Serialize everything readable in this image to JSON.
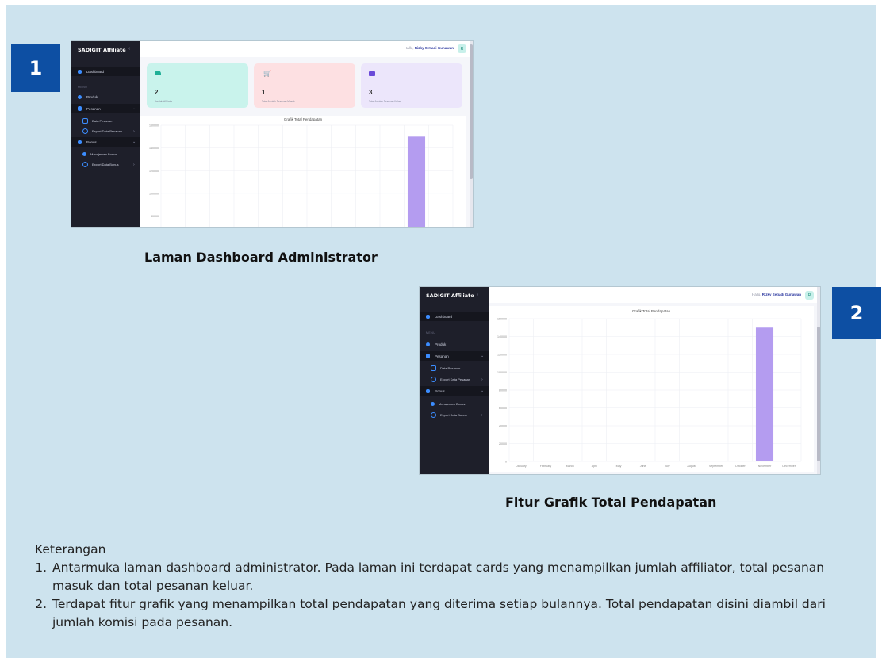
{
  "badges": {
    "first": "1",
    "second": "2"
  },
  "captions": {
    "first": "Laman Dashboard Administrator",
    "second": "Fitur Grafik Total Pendapatan"
  },
  "app": {
    "brand": "SADIGIT Affiliate",
    "greeting_prefix": "Hallo,",
    "user_name": "Rizky Setiadi Gunawan",
    "avatar_initial": "R",
    "sidebar": {
      "dashboard": "Dashboard",
      "section_label": "MENU",
      "produk": "Produk",
      "pesanan": "Pesanan",
      "data_pesanan": "Data Pesanan",
      "export_pesanan": "Export Data Pesanan",
      "bonus": "Bonus",
      "manajemen_bonus": "Manajemen Bonus",
      "export_bonus": "Export Data Bonus"
    },
    "cards": [
      {
        "value": "2",
        "label": "Jumlah Affiliator",
        "icon": "users-icon"
      },
      {
        "value": "1",
        "label": "Total Jumlah Pesanan Masuk",
        "icon": "cart-icon"
      },
      {
        "value": "3",
        "label": "Total Jumlah Pesanan Keluar",
        "icon": "wallet-icon"
      }
    ]
  },
  "colors": {
    "sidebar": "#1e1f2a",
    "card_teal": "#c9f3ec",
    "card_pink": "#fde0e2",
    "card_purple": "#ece6fb",
    "bar": "#b49cf0",
    "badge": "#0d4fa3",
    "panel": "#cde3ee"
  },
  "chart_data": {
    "type": "bar",
    "title": "Grafik Total Pendapatan",
    "categories": [
      "January",
      "February",
      "March",
      "April",
      "May",
      "June",
      "July",
      "August",
      "September",
      "October",
      "November",
      "December"
    ],
    "values": [
      0,
      0,
      0,
      0,
      0,
      0,
      0,
      0,
      0,
      0,
      150000,
      0
    ],
    "yticks": [
      0,
      20000,
      40000,
      60000,
      80000,
      100000,
      120000,
      140000,
      160000
    ],
    "ylim": [
      0,
      160000
    ],
    "grid": true
  },
  "description": {
    "heading": "Keterangan",
    "items": [
      "Antarmuka laman dashboard administrator. Pada laman ini terdapat cards yang menampilkan jumlah affiliator, total pesanan masuk dan total pesanan keluar.",
      "Terdapat fitur grafik yang menampilkan total pendapatan yang diterima setiap bulannya. Total pendapatan disini diambil dari jumlah komisi pada pesanan."
    ]
  }
}
